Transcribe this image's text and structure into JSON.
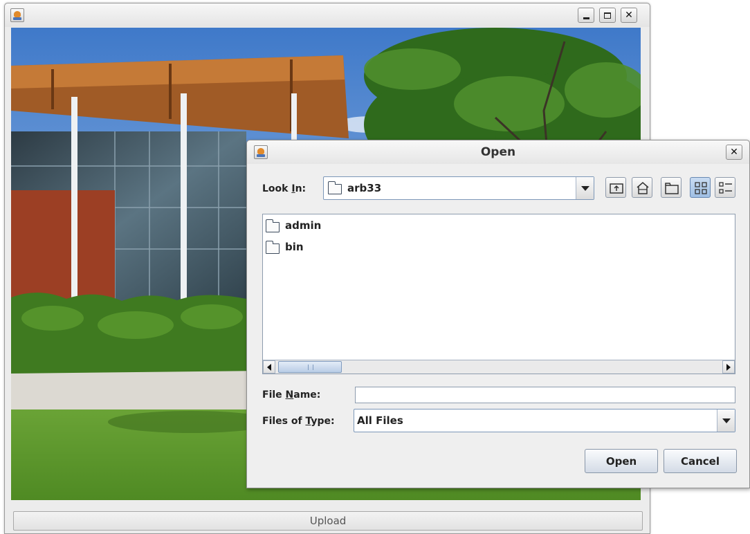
{
  "main_window": {
    "title": "",
    "upload_label": "Upload"
  },
  "dialog": {
    "title": "Open",
    "look_in": {
      "label_pre": "Look ",
      "label_mnemonic": "I",
      "label_post": "n:",
      "value": "arb33"
    },
    "toolbar": [
      "up-one-level-icon",
      "home-icon",
      "new-folder-icon",
      "list-view-icon",
      "details-view-icon"
    ],
    "files": [
      {
        "name": "admin",
        "icon": "folder-icon"
      },
      {
        "name": "bin",
        "icon": "folder-icon"
      }
    ],
    "file_name": {
      "label_pre": "File ",
      "label_mnemonic": "N",
      "label_post": "ame:",
      "value": ""
    },
    "files_of_type": {
      "label_pre": "Files of ",
      "label_mnemonic": "T",
      "label_post": "ype:",
      "value": "All Files"
    },
    "open_label": "Open",
    "cancel_label": "Cancel"
  },
  "colors": {
    "window_bg": "#ececec",
    "selection_accent": "#9fbfe4",
    "field_border": "#7c97b8"
  }
}
